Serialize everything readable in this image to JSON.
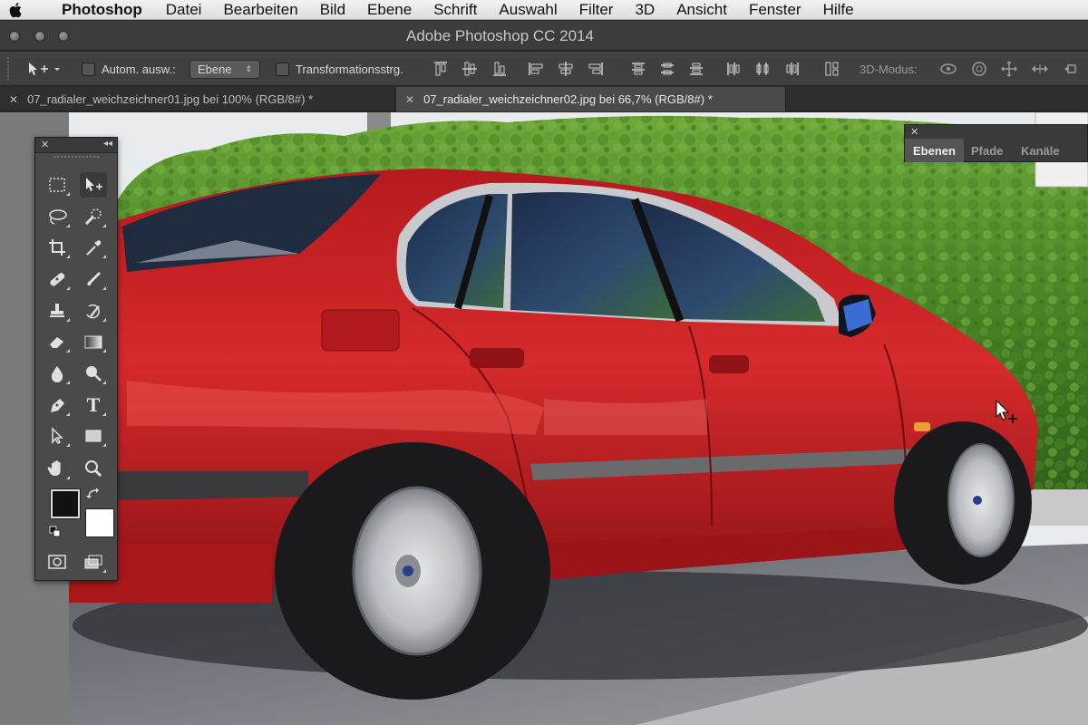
{
  "menubar": {
    "app_name": "Photoshop",
    "items": [
      "Datei",
      "Bearbeiten",
      "Bild",
      "Ebene",
      "Schrift",
      "Auswahl",
      "Filter",
      "3D",
      "Ansicht",
      "Fenster",
      "Hilfe"
    ]
  },
  "window": {
    "title": "Adobe Photoshop CC 2014"
  },
  "options": {
    "auto_select_label": "Autom. ausw.:",
    "auto_select_value": "Ebene",
    "transform_label": "Transformationsstrg.",
    "mode_3d_label": "3D-Modus:"
  },
  "tabs": [
    {
      "label": "07_radialer_weichzeichner01.jpg bei 100% (RGB/8#) *"
    },
    {
      "label": "07_radialer_weichzeichner02.jpg bei 66,7% (RGB/8#) *"
    }
  ],
  "tools": {
    "type_tool_glyph": "T",
    "items": [
      "rectangular-marquee",
      "move",
      "lasso",
      "quick-selection",
      "crop",
      "eyedropper",
      "spot-healing-brush",
      "brush",
      "clone-stamp",
      "history-brush",
      "eraser",
      "gradient",
      "blur",
      "dodge",
      "pen",
      "type",
      "path-selection",
      "rectangle",
      "hand",
      "zoom"
    ],
    "foreground_color": "#111111",
    "background_color": "#ffffff"
  },
  "panels": {
    "tabs": [
      "Ebenen",
      "Pfade",
      "Kanäle"
    ]
  },
  "colors": {
    "car_red": "#c21f22",
    "hedge_green": "#4f8a2a",
    "ui_dark": "#404040"
  }
}
